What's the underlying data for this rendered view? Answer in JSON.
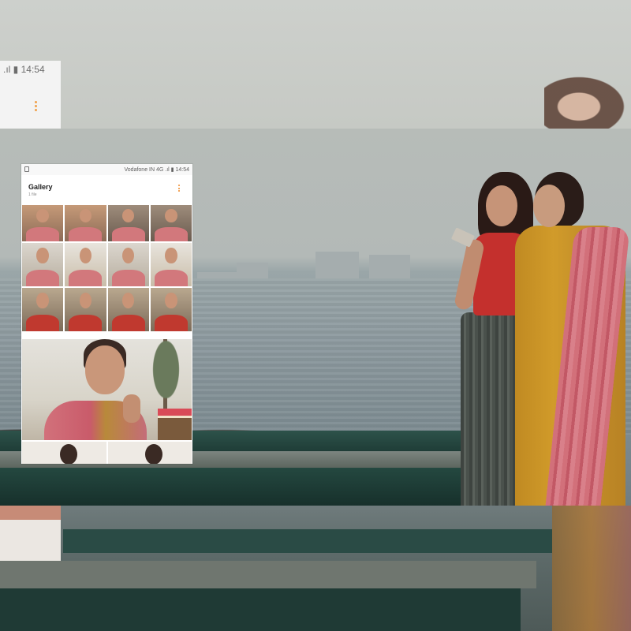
{
  "phone": {
    "status_bar": {
      "carrier_signal": "Vodafone IN 4G",
      "time": "14:54"
    },
    "app": {
      "title": "Gallery",
      "subtitle": "1 file"
    }
  },
  "background_phone": {
    "time": "14:54"
  },
  "colors": {
    "accent": "#ef8a2a",
    "phone_bg": "#ffffff",
    "railing": "#1f3d37"
  },
  "icons": [
    "more-options-icon",
    "gallery-app-icon",
    "signal-icon",
    "battery-icon"
  ]
}
